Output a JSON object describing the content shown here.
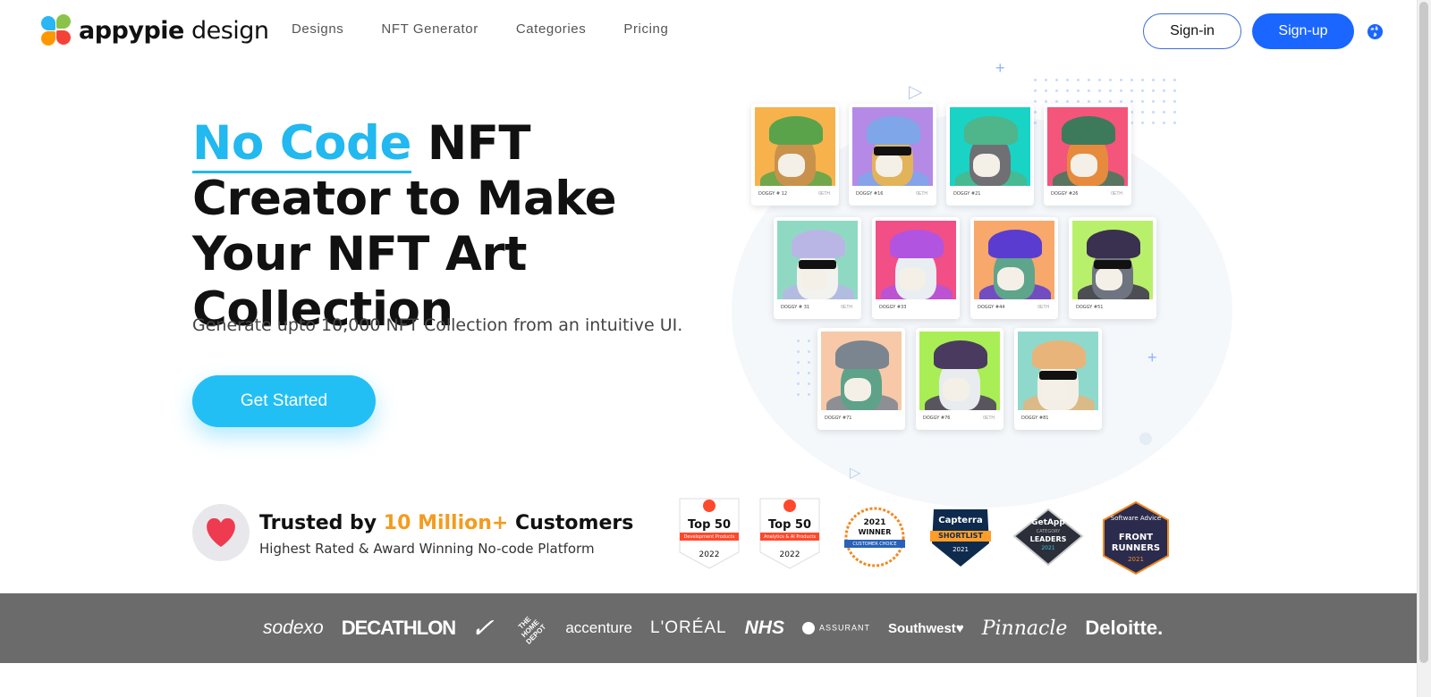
{
  "header": {
    "logo_text_1": "appypie",
    "logo_text_2": " design",
    "nav": [
      "Designs",
      "NFT Generator",
      "Categories",
      "Pricing"
    ],
    "signin_label": "Sign-in",
    "signup_label": "Sign-up"
  },
  "hero": {
    "title_accent": "No Code",
    "title_rest": " NFT Creator to Make Your NFT Art Collection",
    "subtitle": "Generate upto 10,000 NFT Collection from an intuitive UI.",
    "cta_label": "Get Started"
  },
  "nft_cards": [
    {
      "caption": "DOGGY # 12",
      "eth": "0ETH",
      "bg": "#f7b24c",
      "fur": "#c9924c",
      "hat": "#5aa34a"
    },
    {
      "caption": "DOGGY #16",
      "eth": "0ETH",
      "bg": "#b58ae6",
      "fur": "#e3b35a",
      "hat": "#7ea6e8"
    },
    {
      "caption": "DOGGY #21",
      "eth": "",
      "bg": "#19d3c5",
      "fur": "#6f6f74",
      "hat": "#4fb58a"
    },
    {
      "caption": "DOGGY #26",
      "eth": "0ETH",
      "bg": "#f4557a",
      "fur": "#e68a3e",
      "hat": "#3d7a5b"
    },
    {
      "caption": "DOGGY # 31",
      "eth": "0ETH",
      "bg": "#8fd9c3",
      "fur": "#f2f2ee",
      "hat": "#b9b6e6"
    },
    {
      "caption": "DOGGY #33",
      "eth": "",
      "bg": "#f24f86",
      "fur": "#e9eef2",
      "hat": "#b154e0"
    },
    {
      "caption": "DOGGY #44",
      "eth": "0ETH",
      "bg": "#f7a86a",
      "fur": "#5fa58c",
      "hat": "#5a3cd0"
    },
    {
      "caption": "DOGGY #51",
      "eth": "",
      "bg": "#b9f06b",
      "fur": "#6e7580",
      "hat": "#3a3050"
    },
    {
      "caption": "DOGGY #71",
      "eth": "",
      "bg": "#f7c9a8",
      "fur": "#5ea28a",
      "hat": "#7a8590"
    },
    {
      "caption": "DOGGY #76",
      "eth": "0ETH",
      "bg": "#a9ee55",
      "fur": "#e8ecee",
      "hat": "#4a3a60"
    },
    {
      "caption": "DOGGY #81",
      "eth": "",
      "bg": "#8fd9cc",
      "fur": "#f4efe6",
      "hat": "#e8b47a"
    }
  ],
  "trust": {
    "title_1": "Trusted by ",
    "title_highlight": "10 Million+",
    "title_2": " Customers",
    "subtitle": "Highest Rated & Award Winning No-code Platform"
  },
  "badges": [
    {
      "line1": "Top 50",
      "line2": "Development Products",
      "year": "2022"
    },
    {
      "line1": "Top 50",
      "line2": "Analytics & AI Products",
      "year": "2022"
    },
    {
      "line1": "2021",
      "line2": "WINNER",
      "line3": "CUSTOMER CHOICE"
    },
    {
      "line1": "Capterra",
      "line2": "SHORTLIST",
      "year": "2021"
    },
    {
      "line1": "GetApp",
      "line2": "CATEGORY",
      "line3": "LEADERS",
      "year": "2021"
    },
    {
      "line1": "Software Advice",
      "line2": "FRONT",
      "line3": "RUNNERS",
      "year": "2021"
    }
  ],
  "brands": [
    "sodexo",
    "DECATHLON",
    "✓",
    "THE HOME DEPOT",
    "accenture",
    "L'ORÉAL",
    "NHS",
    "ASSURANT",
    "Southwest",
    "Pinnacle",
    "Deloitte."
  ],
  "colors": {
    "accent": "#22b8f0",
    "primary": "#1a66ff",
    "orange": "#f39c1f",
    "strip": "#6b6b6b"
  }
}
